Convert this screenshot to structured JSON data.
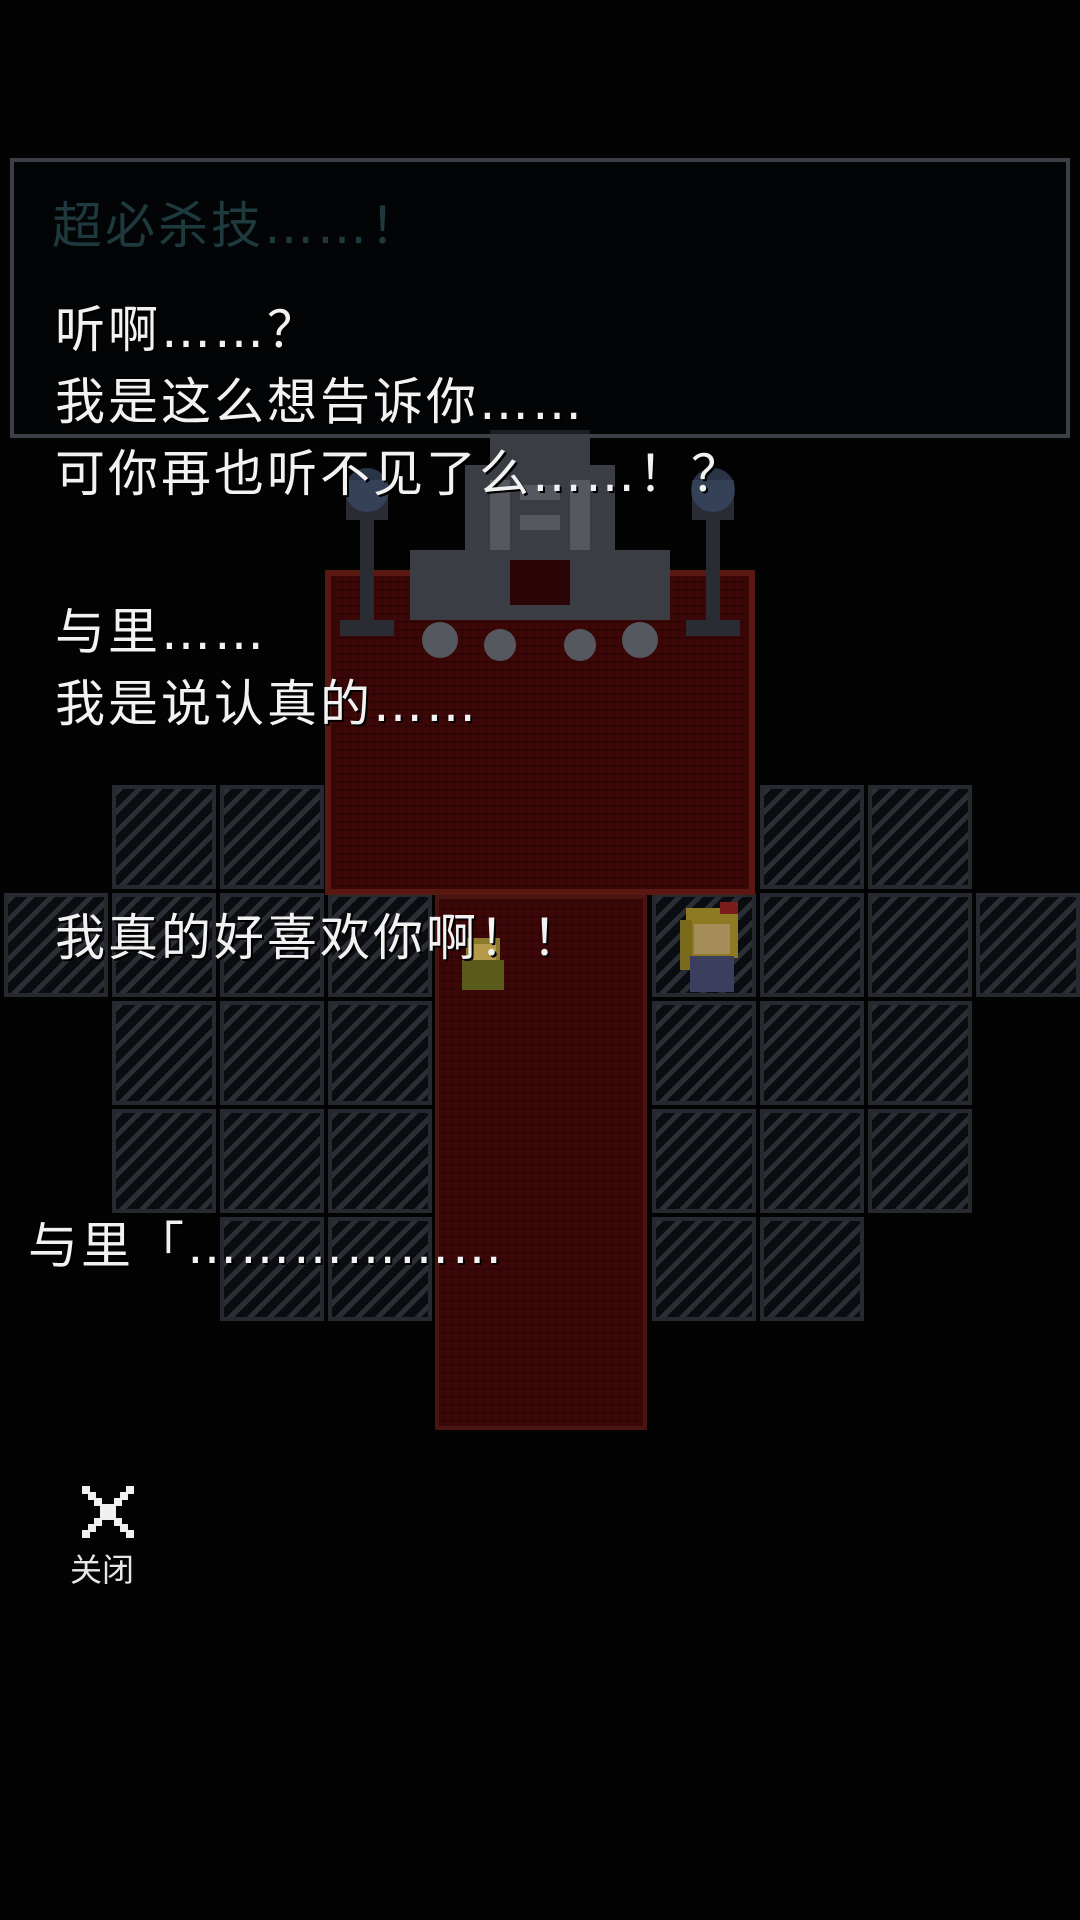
{
  "scene": {
    "title": "超必杀技……！",
    "lines": [
      "听啊……？",
      "我是这么想告诉你……",
      "可你再也听不见了么……！？",
      "与里……",
      "我是说认真的……",
      "我真的好喜欢你啊！！",
      "与里「………………"
    ]
  },
  "controls": {
    "close_label": "关闭",
    "close_icon": "close-icon"
  },
  "colors": {
    "background": "#030303",
    "carpet": "#3e0707",
    "floor_stripe": "#2b2e35",
    "text": "#f2f2f2",
    "title_text": "#1e3a3e"
  }
}
